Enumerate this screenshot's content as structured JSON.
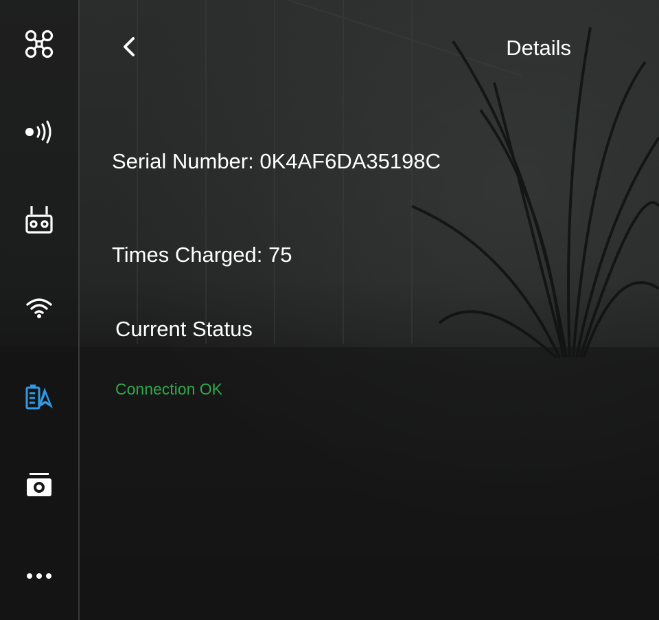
{
  "colors": {
    "accent": "#2d9be9",
    "status_ok": "#2fa84a",
    "icon_default": "#ffffff"
  },
  "sidebar": {
    "items": [
      {
        "icon": "drone-icon",
        "active": false
      },
      {
        "icon": "signal-icon",
        "active": false
      },
      {
        "icon": "remote-controller-icon",
        "active": false
      },
      {
        "icon": "wifi-icon",
        "active": false
      },
      {
        "icon": "battery-icon",
        "active": true
      },
      {
        "icon": "camera-icon",
        "active": false
      },
      {
        "icon": "more-icon",
        "active": false
      }
    ]
  },
  "header": {
    "back_icon": "chevron-left-icon",
    "title": "Details"
  },
  "details": {
    "serial_number_label": "Serial Number: 0K4AF6DA35198C",
    "times_charged_label": "Times Charged: 75",
    "current_status_title": "Current Status",
    "status_text": "Connection OK"
  }
}
